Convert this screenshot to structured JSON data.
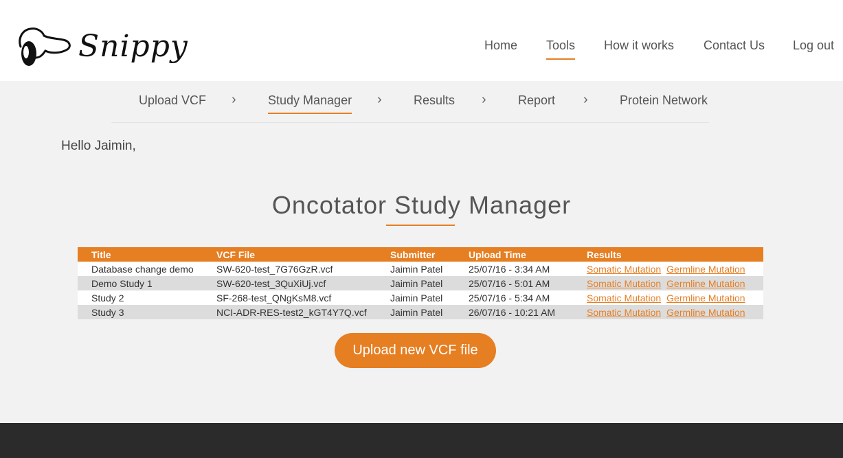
{
  "brand": {
    "name": "Snippy"
  },
  "main_nav": {
    "items": [
      {
        "label": "Home"
      },
      {
        "label": "Tools"
      },
      {
        "label": "How it works"
      },
      {
        "label": "Contact Us"
      },
      {
        "label": "Log out"
      }
    ],
    "active": "Tools"
  },
  "sub_nav": {
    "items": [
      {
        "label": "Upload VCF"
      },
      {
        "label": "Study Manager"
      },
      {
        "label": "Results"
      },
      {
        "label": "Report"
      },
      {
        "label": "Protein Network"
      }
    ],
    "active": "Study Manager",
    "separator_icon": "chevron-right-icon"
  },
  "greeting": "Hello Jaimin,",
  "page_title": "Oncotator Study Manager",
  "table": {
    "headers": [
      "Title",
      "VCF File",
      "Submitter",
      "Upload Time",
      "Results"
    ],
    "rows": [
      {
        "title": "Database change demo",
        "vcf": "SW-620-test_7G76GzR.vcf",
        "submitter": "Jaimin Patel",
        "time": "25/07/16 - 3:34 AM",
        "somatic": "Somatic Mutation",
        "germline": "Germline Mutation"
      },
      {
        "title": "Demo Study 1",
        "vcf": "SW-620-test_3QuXiUj.vcf",
        "submitter": "Jaimin Patel",
        "time": "25/07/16 - 5:01 AM",
        "somatic": "Somatic Mutation",
        "germline": "Germline Mutation"
      },
      {
        "title": "Study 2",
        "vcf": "SF-268-test_QNgKsM8.vcf",
        "submitter": "Jaimin Patel",
        "time": "25/07/16 - 5:34 AM",
        "somatic": "Somatic Mutation",
        "germline": "Germline Mutation"
      },
      {
        "title": "Study 3",
        "vcf": "NCI-ADR-RES-test2_kGT4Y7Q.vcf",
        "submitter": "Jaimin Patel",
        "time": "26/07/16 - 10:21 AM",
        "somatic": "Somatic Mutation",
        "germline": "Germline Mutation"
      }
    ]
  },
  "upload_button": {
    "label": "Upload new VCF file"
  },
  "colors": {
    "accent": "#e67e22",
    "footer": "#2b2b2b",
    "background": "#f2f2f2"
  }
}
